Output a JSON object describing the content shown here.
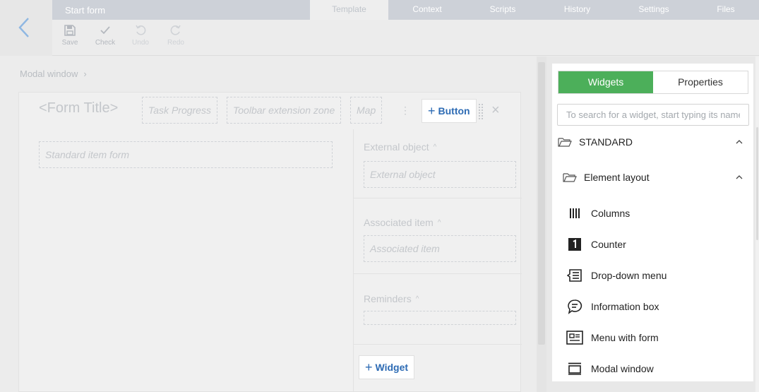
{
  "window": {
    "title": "Start form"
  },
  "tabs": [
    {
      "label": "Template",
      "active": true
    },
    {
      "label": "Context",
      "active": false
    },
    {
      "label": "Scripts",
      "active": false
    },
    {
      "label": "History",
      "active": false
    },
    {
      "label": "Settings",
      "active": false
    },
    {
      "label": "Files",
      "active": false
    }
  ],
  "toolbar": {
    "save": "Save",
    "check": "Check",
    "undo": "Undo",
    "redo": "Redo"
  },
  "breadcrumb": {
    "label": "Modal window"
  },
  "form": {
    "title": "<Form Title>",
    "task_progress": "Task Progress",
    "toolbar_zone": "Toolbar extension zone",
    "map": "Map",
    "add_button": "Button",
    "standard_item_form": "Standard item form"
  },
  "side": {
    "external_object_label": "External object",
    "external_object_field": "External object",
    "associated_item_label": "Associated item",
    "associated_item_field": "Associated item",
    "reminders_label": "Reminders",
    "add_widget": "Widget"
  },
  "panel": {
    "widgets_tab": "Widgets",
    "properties_tab": "Properties",
    "search_placeholder": "To search for a widget, start typing its name",
    "group_standard": "STANDARD",
    "group_layout": "Element layout",
    "items": [
      {
        "label": "Columns",
        "icon": "columns-icon"
      },
      {
        "label": "Counter",
        "icon": "counter-icon"
      },
      {
        "label": "Drop-down menu",
        "icon": "dropdown-menu-icon"
      },
      {
        "label": "Information box",
        "icon": "information-box-icon"
      },
      {
        "label": "Menu with form",
        "icon": "menu-with-form-icon"
      },
      {
        "label": "Modal window",
        "icon": "modal-window-icon"
      }
    ]
  },
  "colors": {
    "accent_green": "#4caf5a",
    "link_blue": "#2d6bb4",
    "topbar": "#cdd1d8"
  }
}
